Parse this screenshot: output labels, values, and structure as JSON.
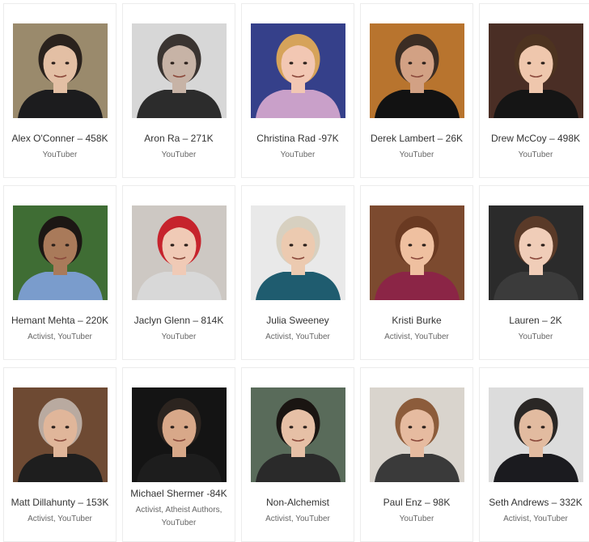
{
  "cards": [
    {
      "name": "Alex O'Conner – 458K",
      "tags": [
        "YouTuber"
      ],
      "bg": "#9a8a6c",
      "skin": "#e3bfa4",
      "hair": "#2a221d",
      "shirt": "#1c1c1e"
    },
    {
      "name": "Aron Ra – 271K",
      "tags": [
        "YouTuber"
      ],
      "bg": "#d7d7d7",
      "skin": "#c7b3a6",
      "hair": "#3a3431",
      "shirt": "#2c2c2c"
    },
    {
      "name": "Christina Rad -97K",
      "tags": [
        "YouTuber"
      ],
      "bg": "#35408a",
      "skin": "#f2c7b3",
      "hair": "#d6a35a",
      "shirt": "#c9a0c9"
    },
    {
      "name": "Derek Lambert – 26K",
      "tags": [
        "YouTuber"
      ],
      "bg": "#b8742e",
      "skin": "#d2a184",
      "hair": "#3b2d24",
      "shirt": "#121212"
    },
    {
      "name": "Drew McCoy – 498K",
      "tags": [
        "YouTuber"
      ],
      "bg": "#4a2e25",
      "skin": "#efc7ad",
      "hair": "#4d3320",
      "shirt": "#151515"
    },
    {
      "name": "Hemant Mehta – 220K",
      "tags": [
        "Activist",
        "YouTuber"
      ],
      "bg": "#3f6d34",
      "skin": "#a97a5a",
      "hair": "#1c1714",
      "shirt": "#7a9ccc"
    },
    {
      "name": "Jaclyn Glenn – 814K",
      "tags": [
        "YouTuber"
      ],
      "bg": "#cdc8c3",
      "skin": "#f0cab6",
      "hair": "#c6232c",
      "shirt": "#d8d8d8"
    },
    {
      "name": "Julia Sweeney",
      "tags": [
        "Activist",
        "YouTuber"
      ],
      "bg": "#e9e9e9",
      "skin": "#eccab0",
      "hair": "#d7d0c0",
      "shirt": "#1f5c6f"
    },
    {
      "name": "Kristi Burke",
      "tags": [
        "Activist",
        "YouTuber"
      ],
      "bg": "#7c4a2f",
      "skin": "#efc0a0",
      "hair": "#6a3a22",
      "shirt": "#8b2546"
    },
    {
      "name": "Lauren – 2K",
      "tags": [
        "YouTuber"
      ],
      "bg": "#2b2b2b",
      "skin": "#f0cdb8",
      "hair": "#5a3a28",
      "shirt": "#3b3b3b"
    },
    {
      "name": "Matt Dillahunty – 153K",
      "tags": [
        "Activist",
        "YouTuber"
      ],
      "bg": "#6e4a33",
      "skin": "#e0b69a",
      "hair": "#b9aaa0",
      "shirt": "#1e1e1e"
    },
    {
      "name": "Michael Shermer -84K",
      "tags": [
        "Activist",
        "Atheist Authors",
        "YouTuber"
      ],
      "bg": "#141414",
      "skin": "#d8a889",
      "hair": "#2c241f",
      "shirt": "#1d1d1d"
    },
    {
      "name": "Non-Alchemist",
      "tags": [
        "Activist",
        "YouTuber"
      ],
      "bg": "#596b5a",
      "skin": "#e6c0a6",
      "hair": "#1a1512",
      "shirt": "#2a2a2a"
    },
    {
      "name": "Paul Enz – 98K",
      "tags": [
        "YouTuber"
      ],
      "bg": "#d9d4cd",
      "skin": "#e6bba0",
      "hair": "#8c5c3b",
      "shirt": "#3a3a3a"
    },
    {
      "name": "Seth Andrews – 332K",
      "tags": [
        "Activist",
        "YouTuber"
      ],
      "bg": "#dcdcdc",
      "skin": "#e2bba0",
      "hair": "#2a2725",
      "shirt": "#1b1b1f"
    }
  ]
}
